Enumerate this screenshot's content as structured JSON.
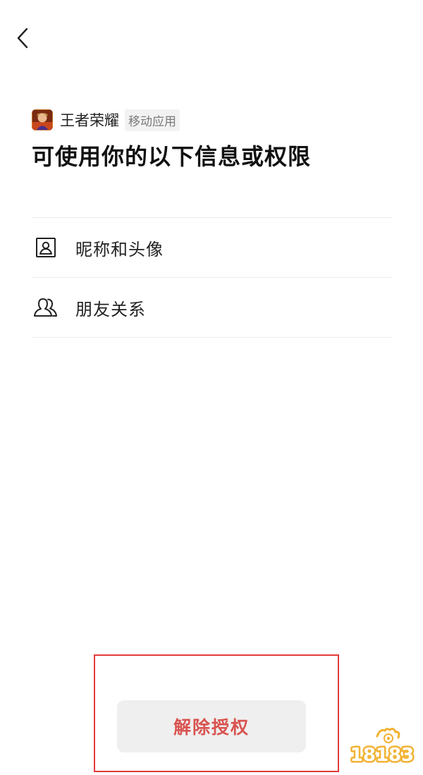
{
  "app": {
    "name": "王者荣耀",
    "tag": "移动应用",
    "icon": "game-app-icon"
  },
  "page": {
    "title": "可使用你的以下信息或权限"
  },
  "permissions": [
    {
      "label": "昵称和头像",
      "icon": "profile-card-icon"
    },
    {
      "label": "朋友关系",
      "icon": "friends-icon"
    }
  ],
  "actions": {
    "revoke_label": "解除授权"
  },
  "watermark": {
    "text": "18183"
  },
  "colors": {
    "revoke_text": "#d9534f",
    "highlight_border": "#e23b3b",
    "button_bg": "#efefef",
    "divider": "#ececec"
  }
}
